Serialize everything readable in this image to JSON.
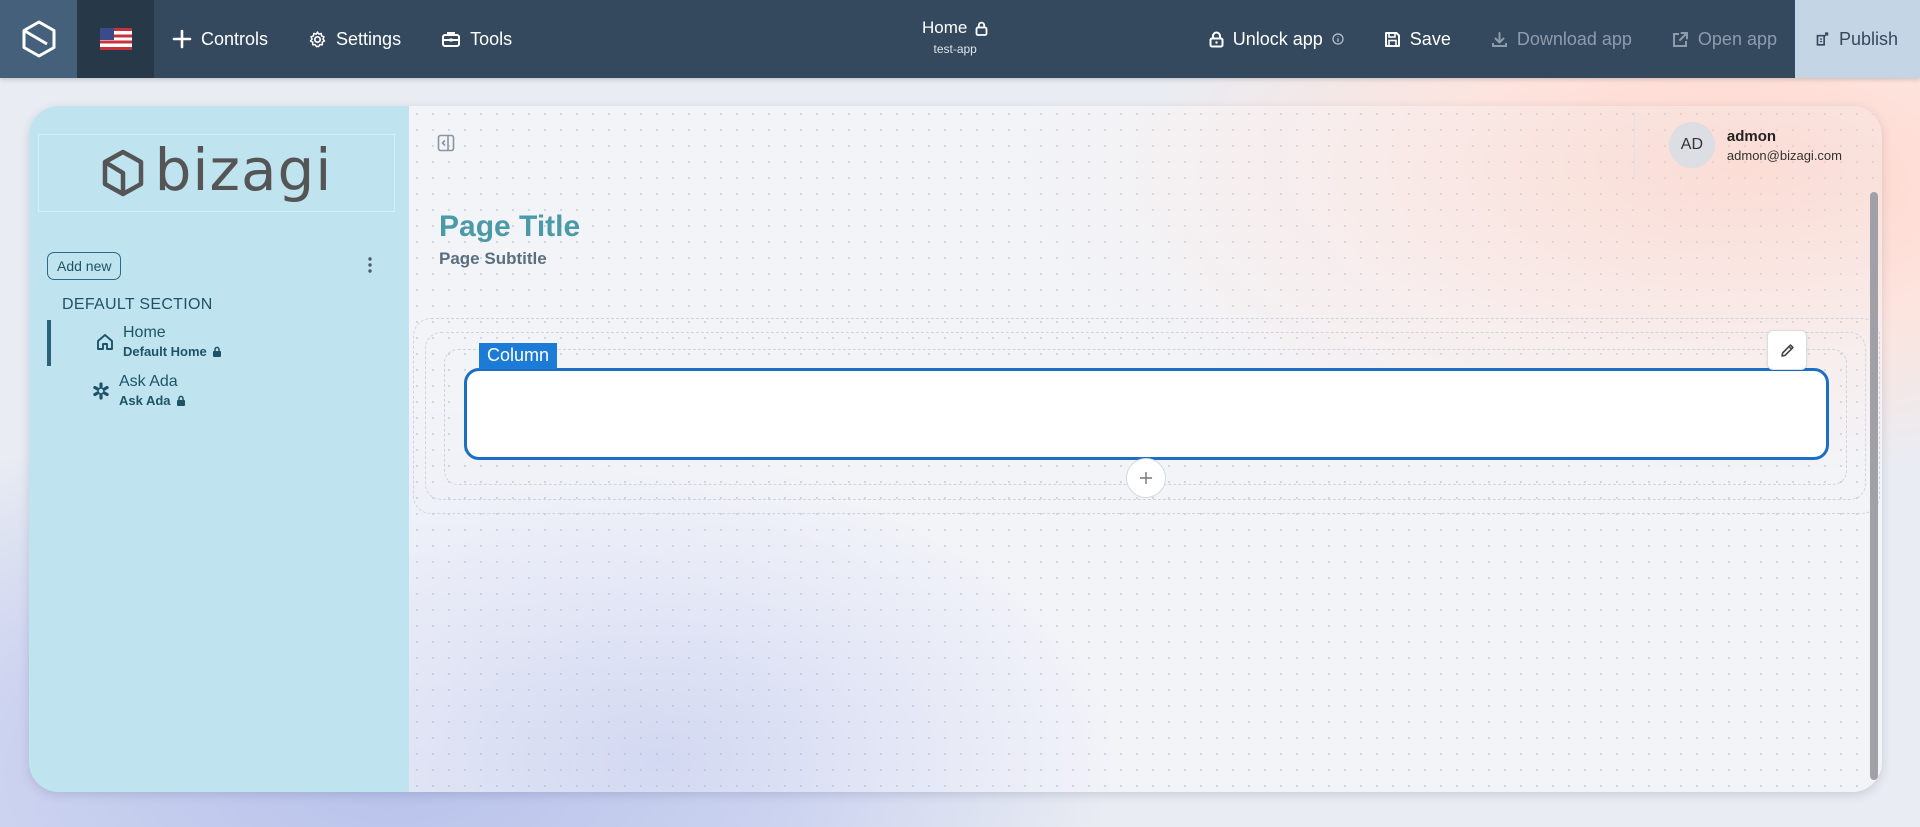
{
  "topbar": {
    "controls_label": "Controls",
    "settings_label": "Settings",
    "tools_label": "Tools",
    "page_name": "Home",
    "app_name": "test-app",
    "unlock_label": "Unlock app",
    "save_label": "Save",
    "download_label": "Download app",
    "open_label": "Open app",
    "publish_label": "Publish"
  },
  "sidebar": {
    "brand": "bizagi",
    "add_new_label": "Add new",
    "section_title": "DEFAULT SECTION",
    "items": [
      {
        "name": "Home",
        "description": "Default Home",
        "icon": "home-icon",
        "active": true
      },
      {
        "name": "Ask Ada",
        "description": "Ask Ada",
        "icon": "asterisk-icon",
        "active": false
      }
    ]
  },
  "user": {
    "initials": "AD",
    "name": "admon",
    "email": "admon@bizagi.com"
  },
  "page": {
    "title": "Page Title",
    "subtitle": "Page Subtitle"
  },
  "canvas": {
    "column_label": "Column"
  },
  "colors": {
    "topbar": "#34495e",
    "sidebar": "#bfe4f0",
    "accent": "#1c7bd6",
    "page_title": "#4a9aa8"
  }
}
